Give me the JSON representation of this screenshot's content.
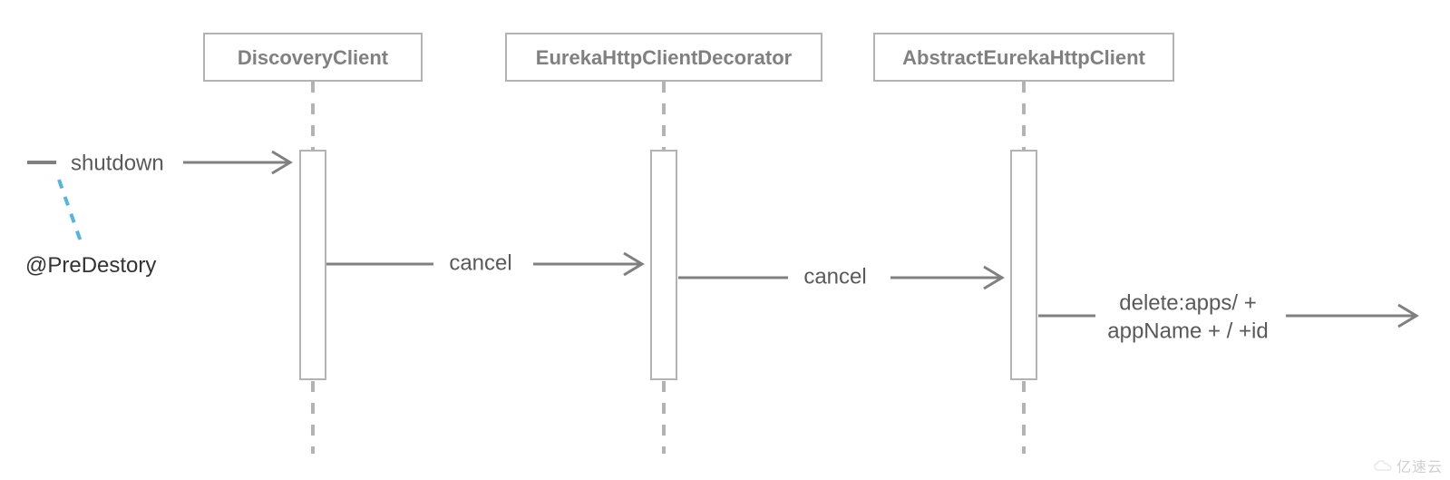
{
  "participants": {
    "p1": {
      "label": "DiscoveryClient"
    },
    "p2": {
      "label": "EurekaHttpClientDecorator"
    },
    "p3": {
      "label": "AbstractEurekaHttpClient"
    }
  },
  "messages": {
    "m0": {
      "label": "shutdown"
    },
    "m1": {
      "label": "cancel"
    },
    "m2": {
      "label": "cancel"
    },
    "m3a": {
      "label": "delete:apps/ +"
    },
    "m3b": {
      "label": "appName + / +id"
    }
  },
  "notes": {
    "n1": {
      "label": "@PreDestory"
    }
  },
  "watermark": {
    "text": "亿速云"
  }
}
